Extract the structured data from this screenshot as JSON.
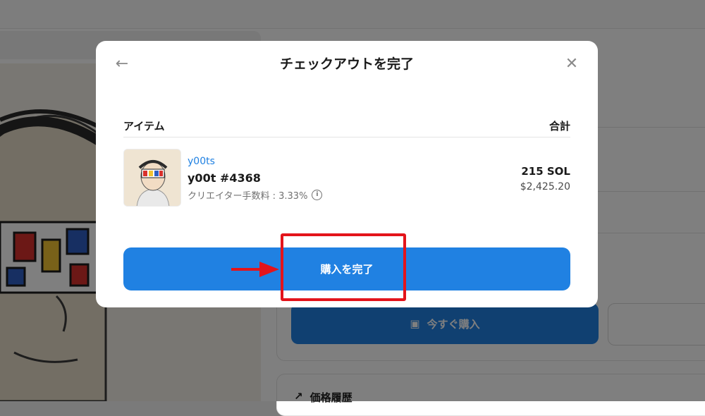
{
  "modal": {
    "title": "チェックアウトを完了",
    "back_icon": "arrow-left-icon",
    "close_icon": "close-icon",
    "columns": {
      "item": "アイテム",
      "total": "合計"
    },
    "item": {
      "collection": "y00ts",
      "name": "y00t #4368",
      "creator_fee": "クリエイター手数料 : 3.33%",
      "price_sol": "215 SOL",
      "price_usd": "$2,425.20"
    },
    "complete_button": "購入を完了"
  },
  "background": {
    "buy_now_button": "今すぐ購入",
    "price_history_title": "価格履歴"
  },
  "colors": {
    "accent": "#2081e2",
    "annotation": "#e3141b"
  }
}
